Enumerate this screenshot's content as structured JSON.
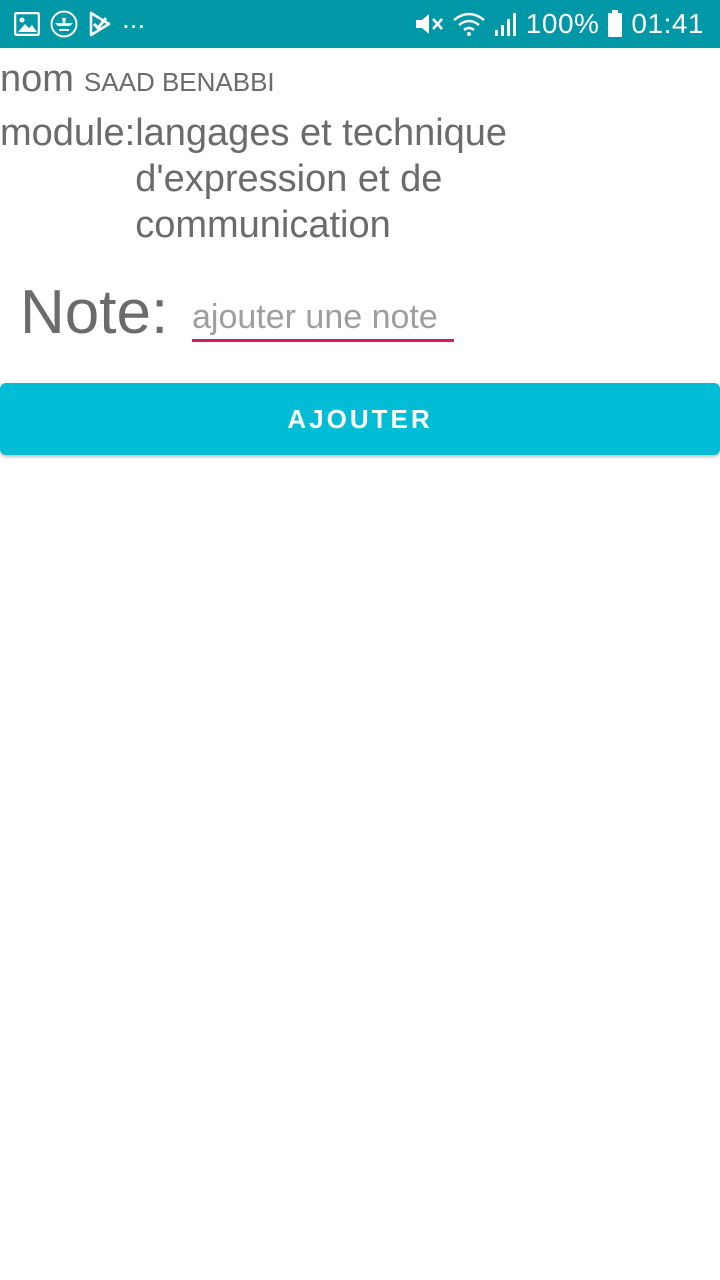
{
  "status_bar": {
    "left_icons": [
      "image-icon",
      "app-icon",
      "check-icon"
    ],
    "more": "...",
    "battery_percent": "100%",
    "time": "01:41",
    "right_icons": [
      "mute-icon",
      "wifi-icon",
      "signal-icon",
      "battery-icon"
    ],
    "color": "#0097A7"
  },
  "form": {
    "nom_label": "nom",
    "nom_value": "SAAD BENABBI",
    "module_label": "module:",
    "module_value": "langages et technique d'expression et de communication",
    "note_label": "Note:",
    "note_value": "",
    "note_placeholder": "ajouter une note",
    "underline_color": "#D81B60"
  },
  "actions": {
    "add_label": "AJOUTER",
    "button_color": "#00BCD4"
  }
}
